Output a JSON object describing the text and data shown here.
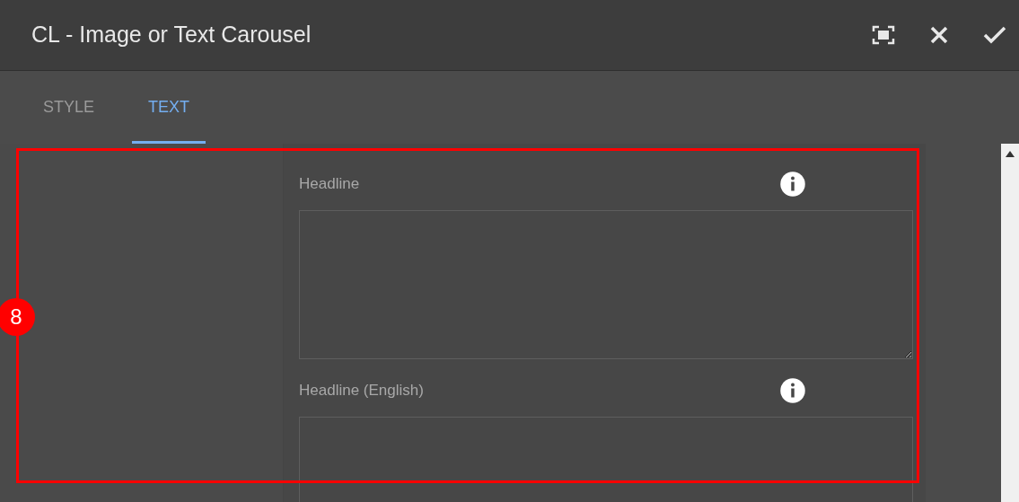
{
  "dialog": {
    "title": "CL - Image or Text Carousel"
  },
  "tabs": [
    {
      "label": "STYLE",
      "selected": false
    },
    {
      "label": "TEXT",
      "selected": true
    }
  ],
  "fields": [
    {
      "label": "Headline"
    },
    {
      "label": "Headline (English)"
    }
  ],
  "annotation": {
    "label": "8"
  }
}
